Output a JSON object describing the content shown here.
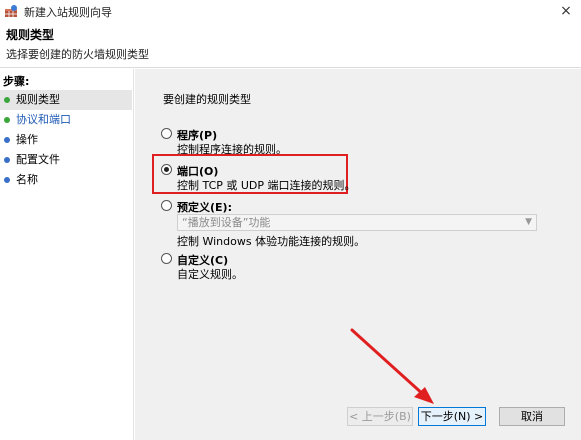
{
  "window": {
    "title": "新建入站规则向导",
    "close": "×"
  },
  "header": {
    "title": "规则类型",
    "subtitle": "选择要创建的防火墙规则类型"
  },
  "steps": {
    "title": "步骤:",
    "items": [
      {
        "label": "规则类型",
        "state": "active"
      },
      {
        "label": "协议和端口",
        "state": "link"
      },
      {
        "label": "操作",
        "state": "normal"
      },
      {
        "label": "配置文件",
        "state": "normal"
      },
      {
        "label": "名称",
        "state": "normal"
      }
    ]
  },
  "main": {
    "prompt": "要创建的规则类型",
    "options": [
      {
        "label": "程序(P)",
        "desc": "控制程序连接的规则。",
        "checked": false
      },
      {
        "label": "端口(O)",
        "desc": "控制 TCP 或 UDP 端口连接的规则。",
        "checked": true
      },
      {
        "label": "预定义(E):",
        "desc": "控制 Windows 体验功能连接的规则。",
        "checked": false
      },
      {
        "label": "自定义(C)",
        "desc": "自定义规则。",
        "checked": false
      }
    ],
    "predefined_select": "“播放到设备”功能"
  },
  "buttons": {
    "back": "< 上一步(B)",
    "next": "下一步(N) >",
    "cancel": "取消"
  },
  "colors": {
    "highlight": "#e02020",
    "link": "#1e5bb4",
    "panel": "#f0f0f0"
  }
}
